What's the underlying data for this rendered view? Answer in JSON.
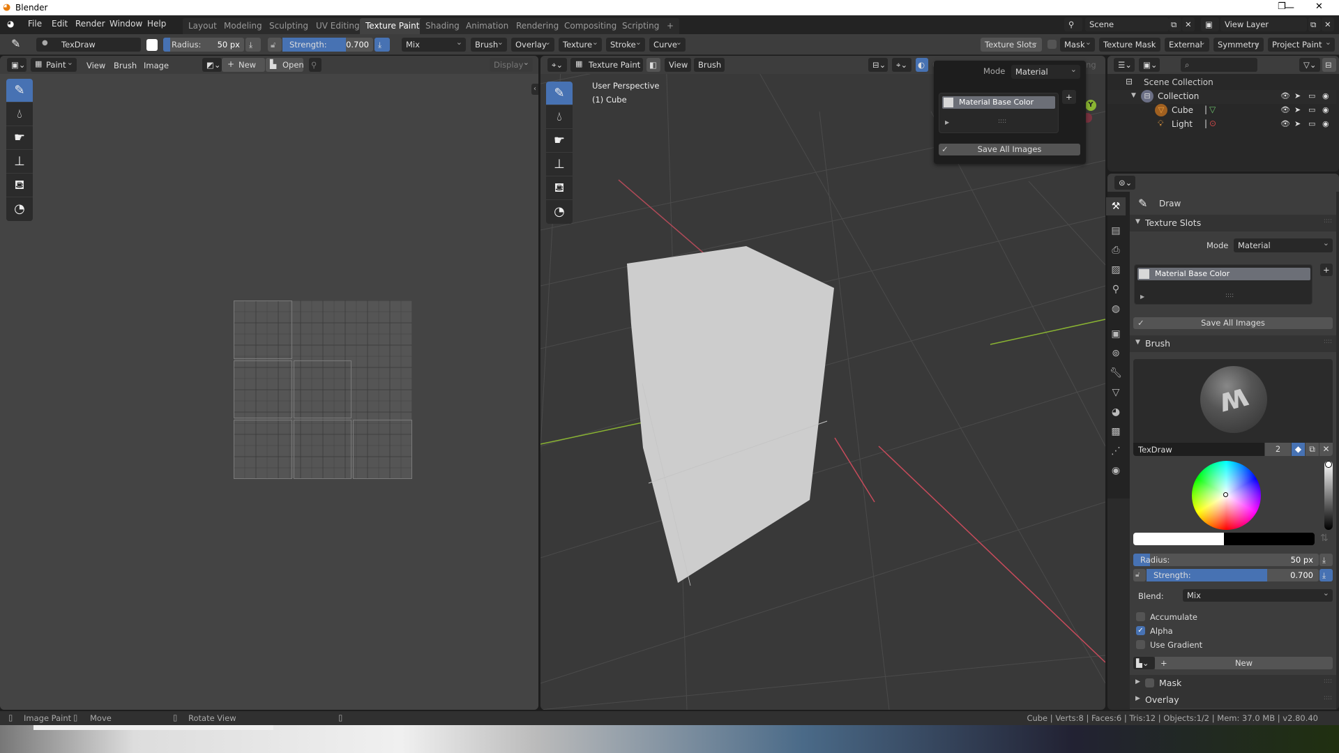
{
  "window": {
    "title": "Blender",
    "minimize": "—",
    "maximize": "❐",
    "close": "✕"
  },
  "menu": [
    "File",
    "Edit",
    "Render",
    "Window",
    "Help"
  ],
  "workspaces": [
    {
      "label": "Layout",
      "active": false
    },
    {
      "label": "Modeling",
      "active": false
    },
    {
      "label": "Sculpting",
      "active": false
    },
    {
      "label": "UV Editing",
      "active": false
    },
    {
      "label": "Texture Paint",
      "active": true
    },
    {
      "label": "Shading",
      "active": false
    },
    {
      "label": "Animation",
      "active": false
    },
    {
      "label": "Rendering",
      "active": false
    },
    {
      "label": "Compositing",
      "active": false
    },
    {
      "label": "Scripting",
      "active": false
    }
  ],
  "add_workspace": "+",
  "scene": {
    "name": "Scene",
    "view_layer": "View Layer"
  },
  "toolbar": {
    "brush_name": "TexDraw",
    "radius_label": "Radius:",
    "radius_value": "50 px",
    "strength_label": "Strength:",
    "strength_value": "0.700",
    "strength_fraction": 0.7,
    "blend": "Mix",
    "menus": [
      "Brush",
      "Overlay",
      "Texture",
      "Stroke",
      "Curve"
    ],
    "right_menus": [
      "Texture Slots",
      "Mask",
      "Texture Mask",
      "External",
      "Symmetry",
      "Project Paint"
    ]
  },
  "image_editor": {
    "mode": "Paint",
    "menus": [
      "View",
      "Brush",
      "Image"
    ],
    "new_label": "New",
    "open_label": "Open",
    "display_label": "Display"
  },
  "viewport": {
    "mode": "Texture Paint",
    "menus": [
      "View",
      "Brush"
    ],
    "perspective": "User Perspective",
    "object": "(1) Cube",
    "overlays_label": "Overlays",
    "shading_label": "Shading",
    "gizmo_y": "Y"
  },
  "texture_slots_popover": {
    "mode_label": "Mode",
    "mode_value": "Material",
    "slot": "Material Base Color",
    "save_all": "Save All Images"
  },
  "outliner": {
    "root": "Scene Collection",
    "items": [
      {
        "name": "Collection",
        "type": "collection"
      },
      {
        "name": "Cube",
        "type": "mesh"
      },
      {
        "name": "Light",
        "type": "light"
      }
    ]
  },
  "properties": {
    "tool_name": "Draw",
    "texture_slots": {
      "header": "Texture Slots",
      "mode_label": "Mode",
      "mode_value": "Material",
      "slot": "Material Base Color",
      "save_all": "Save All Images"
    },
    "brush": {
      "header": "Brush",
      "name": "TexDraw",
      "users": "2",
      "radius_label": "Radius:",
      "radius_value": "50 px",
      "strength_label": "Strength:",
      "strength_value": "0.700",
      "strength_fraction": 0.7,
      "blend_label": "Blend:",
      "blend_value": "Mix",
      "accumulate": {
        "label": "Accumulate",
        "checked": false
      },
      "alpha": {
        "label": "Alpha",
        "checked": true
      },
      "use_gradient": {
        "label": "Use Gradient",
        "checked": false
      },
      "new_label": "New"
    },
    "mask": {
      "header": "Mask",
      "checked": false
    },
    "overlay": {
      "header": "Overlay"
    }
  },
  "statusbar": {
    "left": [
      "Image Paint",
      "Move",
      "Rotate View"
    ],
    "right": "Cube | Verts:8 | Faces:6 | Tris:12 | Objects:1/2 | Mem: 37.0 MB | v2.80.40"
  },
  "colors": {
    "accent": "#4772b3",
    "header": "#3d3d3d",
    "panel": "#2b2b2b",
    "x_axis": "#c74b5b",
    "y_axis": "#8ab432"
  }
}
